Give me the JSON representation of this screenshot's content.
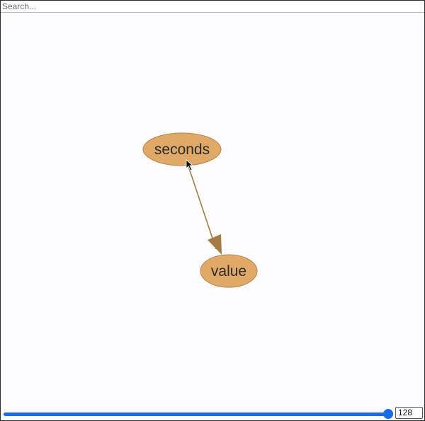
{
  "search": {
    "placeholder": "Search...",
    "value": ""
  },
  "graph": {
    "nodes": [
      {
        "id": "seconds",
        "label": "seconds"
      },
      {
        "id": "value",
        "label": "value"
      }
    ],
    "edges": [
      {
        "from": "seconds",
        "to": "value"
      }
    ],
    "colors": {
      "node_fill": "#e0a968",
      "node_stroke": "#b5854b",
      "edge": "#a57a44"
    }
  },
  "slider": {
    "value": "128",
    "fill_fraction": 1.0,
    "accent": "#1a6be8"
  }
}
